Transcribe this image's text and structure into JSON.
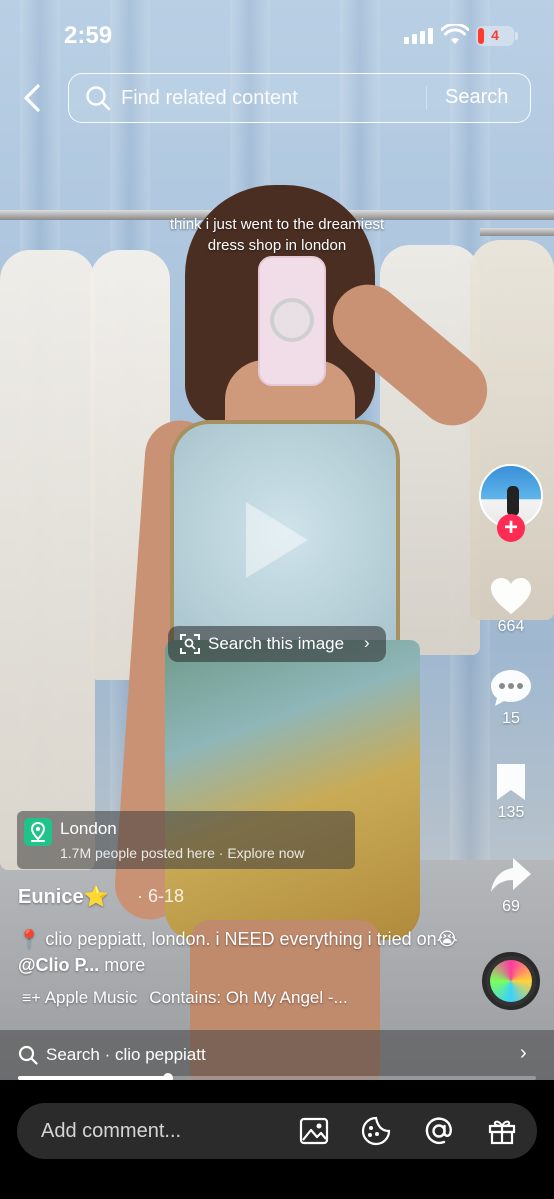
{
  "status_bar": {
    "time": "2:59",
    "battery": "4"
  },
  "search": {
    "placeholder": "Find related content",
    "button_label": "Search"
  },
  "caption": "think i just went to the dreamiest dress shop in london",
  "search_image_label": "Search this image",
  "rail": {
    "likes": "664",
    "comments": "15",
    "saves": "135",
    "shares": "69"
  },
  "location": {
    "name": "London",
    "subtitle": "1.7M people posted here · Explore now"
  },
  "author": {
    "name": "Eunice",
    "emoji": "⭐",
    "date": "6-18"
  },
  "description": {
    "text": "📍 clio peppiatt, london. i NEED everything i tried on😭 ",
    "mention": "@Clio P...",
    "more": " more"
  },
  "music": {
    "label": "Apple Music",
    "contains": "Contains: Oh My Angel -..."
  },
  "related_search": {
    "text": "Search · clio peppiatt"
  },
  "progress": {
    "fraction": 0.29
  },
  "comment": {
    "placeholder": "Add comment..."
  },
  "icons": [
    "back-icon",
    "search-icon",
    "heart-icon",
    "comment-icon",
    "bookmark-icon",
    "share-icon",
    "image-icon",
    "emoji-icon",
    "at-icon",
    "gift-icon"
  ],
  "colors": {
    "accent": "#fe2c55",
    "location_pin": "#20c48a",
    "battery_low": "#ff3b30"
  }
}
